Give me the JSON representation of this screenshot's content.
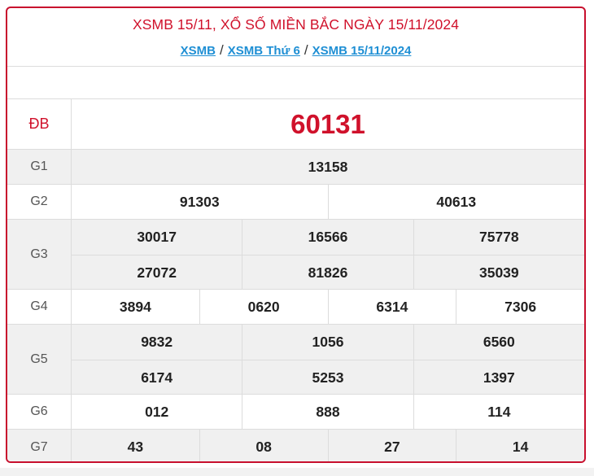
{
  "header": {
    "title": "XSMB 15/11, XỔ SỐ MIỀN BẮC NGÀY 15/11/2024",
    "breadcrumbs": [
      "XSMB",
      "XSMB Thứ 6",
      "XSMB 15/11/2024"
    ],
    "separator": "/"
  },
  "rows": {
    "db": {
      "label": "ĐB",
      "values": [
        "60131"
      ]
    },
    "g1": {
      "label": "G1",
      "values": [
        "13158"
      ]
    },
    "g2": {
      "label": "G2",
      "values": [
        "91303",
        "40613"
      ]
    },
    "g3": {
      "label": "G3",
      "values": [
        "30017",
        "16566",
        "75778",
        "27072",
        "81826",
        "35039"
      ]
    },
    "g4": {
      "label": "G4",
      "values": [
        "3894",
        "0620",
        "6314",
        "7306"
      ]
    },
    "g5": {
      "label": "G5",
      "values": [
        "9832",
        "1056",
        "6560",
        "6174",
        "5253",
        "1397"
      ]
    },
    "g6": {
      "label": "G6",
      "values": [
        "012",
        "888",
        "114"
      ]
    },
    "g7": {
      "label": "G7",
      "values": [
        "43",
        "08",
        "27",
        "14"
      ]
    }
  },
  "colors": {
    "accent": "#d0112b",
    "link": "#1f8fd4",
    "row_alt": "#f0f0f0"
  }
}
